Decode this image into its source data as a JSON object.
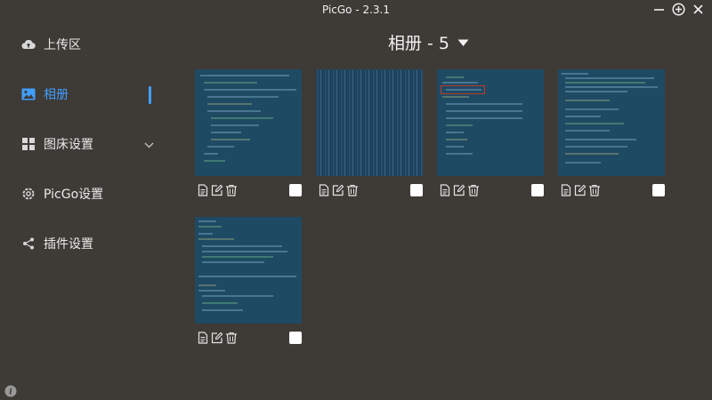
{
  "window": {
    "title": "PicGo - 2.3.1"
  },
  "sidebar": {
    "items": [
      {
        "label": "上传区",
        "icon": "cloud-upload-icon"
      },
      {
        "label": "相册",
        "icon": "image-icon"
      },
      {
        "label": "图床设置",
        "icon": "grid-icon"
      },
      {
        "label": "PicGo设置",
        "icon": "gear-icon"
      },
      {
        "label": "插件设置",
        "icon": "share-icon"
      }
    ],
    "active_index": 1
  },
  "header": {
    "title": "相册 - 5"
  },
  "gallery": {
    "count": 5
  },
  "colors": {
    "accent": "#409eff",
    "background": "#3e3a36"
  }
}
